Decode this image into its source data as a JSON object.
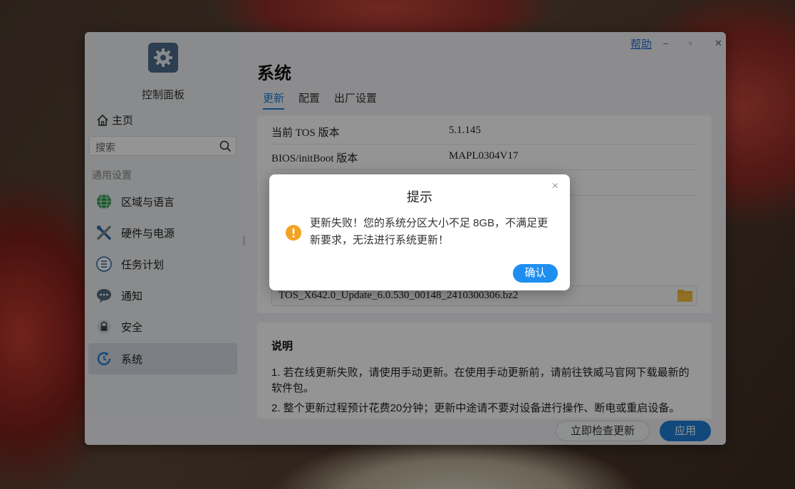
{
  "window": {
    "app_title": "控制面板",
    "help_link": "帮助",
    "min_glyph": "–",
    "max_glyph": "▫",
    "close_glyph": "✕"
  },
  "sidebar": {
    "home": "主页",
    "search_placeholder": "搜索",
    "section": "通用设置",
    "items": [
      {
        "label": "区域与语言",
        "icon": "globe-icon"
      },
      {
        "label": "硬件与电源",
        "icon": "tools-icon"
      },
      {
        "label": "任务计划",
        "icon": "task-list-icon"
      },
      {
        "label": "通知",
        "icon": "chat-bubble-icon"
      },
      {
        "label": "安全",
        "icon": "lock-icon"
      },
      {
        "label": "系统",
        "icon": "system-update-icon"
      }
    ]
  },
  "main": {
    "title": "系统",
    "tabs": [
      "更新",
      "配置",
      "出厂设置"
    ],
    "info_rows": [
      {
        "key": "当前 TOS 版本",
        "value": "5.1.145"
      },
      {
        "key": "BIOS/initBoot 版本",
        "value": "MAPL0304V17"
      }
    ],
    "update_file": "TOS_X642.0_Update_6.0.530_00148_2410300306.bz2",
    "notes": {
      "heading": "说明",
      "items": [
        "1. 若在线更新失败，请使用手动更新。在使用手动更新前，请前往铁威马官网下载最新的软件包。",
        "2. 整个更新过程预计花费20分钟；更新中途请不要对设备进行操作、断电或重启设备。"
      ]
    },
    "footer": {
      "check_button": "立即检查更新",
      "apply_button": "应用"
    }
  },
  "dialog": {
    "title": "提示",
    "message": "更新失败！您的系统分区大小不足 8GB，不满足更新要求，无法进行系统更新！",
    "confirm": "确认",
    "close_glyph": "×"
  },
  "colors": {
    "accent": "#1e7fd8",
    "warning": "#f4a222"
  }
}
